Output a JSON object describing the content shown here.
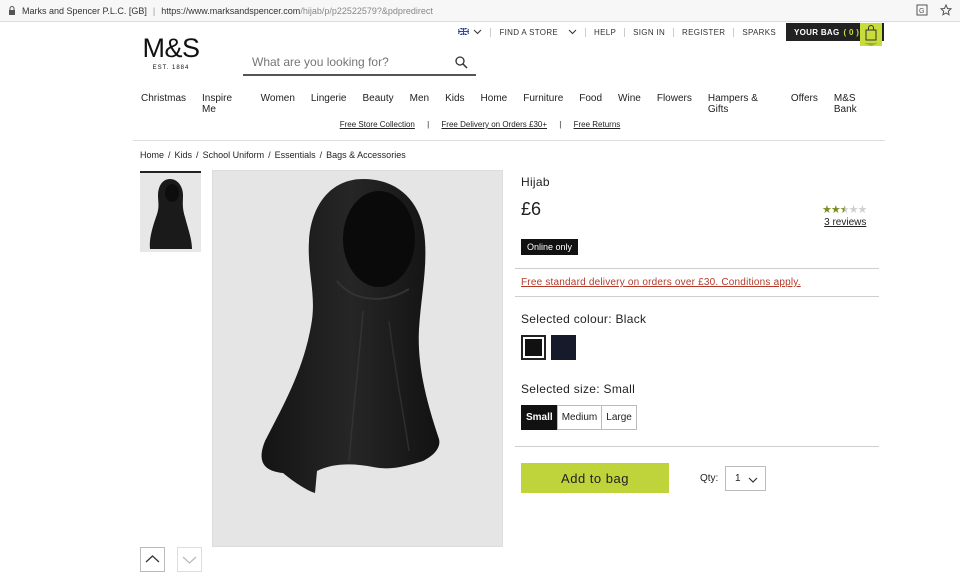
{
  "browser": {
    "site_identity": "Marks and Spencer P.L.C. [GB]",
    "url_main": "https://www.marksandspencer.com",
    "url_path": "/hijab/p/p22522579?&pdpredirect"
  },
  "utility": {
    "find_store": "FIND A STORE",
    "help": "HELP",
    "sign_in": "SIGN IN",
    "register": "REGISTER",
    "sparks": "SPARKS",
    "bag_label": "YOUR BAG",
    "bag_count": "( 0 )"
  },
  "logo": {
    "text": "M&S",
    "est": "EST. 1884"
  },
  "search": {
    "placeholder": "What are you looking for?"
  },
  "nav": [
    "Christmas",
    "Inspire Me",
    "Women",
    "Lingerie",
    "Beauty",
    "Men",
    "Kids",
    "Home",
    "Furniture",
    "Food",
    "Wine",
    "Flowers",
    "Hampers & Gifts",
    "Offers",
    "M&S Bank"
  ],
  "promo": {
    "item1": "Free Store Collection",
    "item2": "Free Delivery on Orders £30+",
    "item3": "Free Returns",
    "separator": "|"
  },
  "breadcrumb": [
    "Home",
    "Kids",
    "School Uniform",
    "Essentials",
    "Bags & Accessories"
  ],
  "breadcrumb_sep": "/",
  "product": {
    "title": "Hijab",
    "price": "£6",
    "rating": 2.5,
    "reviews": "3 reviews",
    "badge": "Online only",
    "delivery_note": "Free standard delivery on orders over £30. Conditions apply.",
    "colour_label": "Selected colour: Black",
    "colours": [
      "Black",
      "Navy"
    ],
    "size_label": "Selected size: Small",
    "sizes": [
      "Small",
      "Medium",
      "Large"
    ],
    "selected_size": "Small",
    "add_to_bag": "Add to bag",
    "qty_label": "Qty:",
    "qty_value": "1"
  },
  "colors": {
    "accent": "#bfd43a",
    "link_red": "#b33a2a",
    "dark": "#111111"
  }
}
